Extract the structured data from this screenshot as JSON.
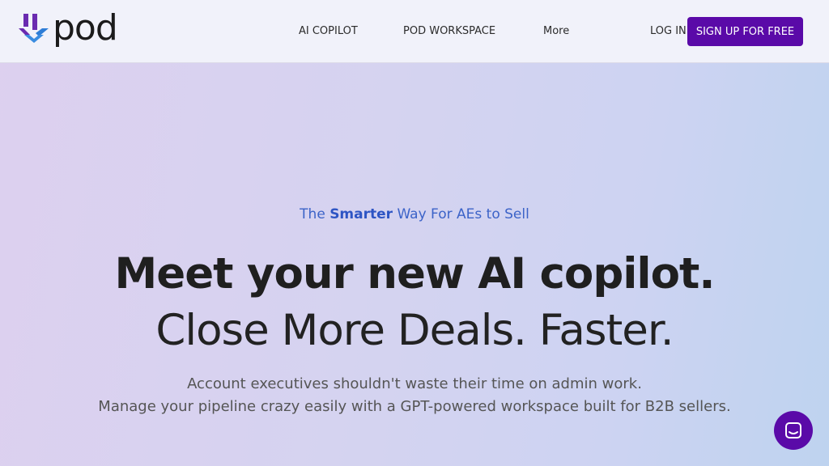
{
  "nav": {
    "logo_text": "pod",
    "links": [
      "AI COPILOT",
      "POD WORKSPACE",
      "More"
    ],
    "login": "LOG IN",
    "signup": "SIGN UP FOR FREE"
  },
  "hero": {
    "tagline_pre": "The ",
    "tagline_bold": "Smarter",
    "tagline_post": " Way For AEs to Sell",
    "headline": "Meet your new AI copilot.",
    "subheadline": "Close More Deals. Faster.",
    "desc_line1": "Account executives shouldn't waste their time on admin work.",
    "desc_line2": "Manage your pipeline crazy easily with a GPT-powered workspace built for B2B sellers."
  },
  "colors": {
    "brand_purple": "#5a0aa8",
    "accent_blue": "#3c63c8"
  },
  "chat": {
    "icon": "chat-icon"
  }
}
